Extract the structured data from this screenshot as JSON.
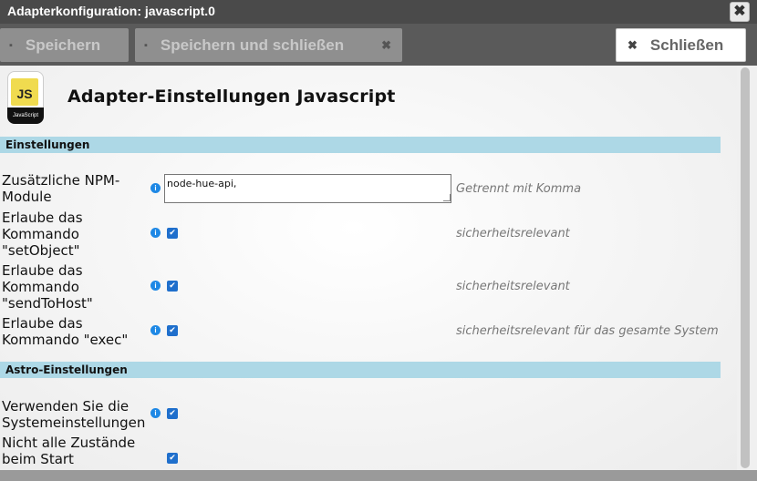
{
  "window": {
    "title": "Adapterkonfiguration: javascript.0",
    "close_glyph": "✖"
  },
  "toolbar": {
    "save_label": "Speichern",
    "save_close_label": "Speichern und schließen",
    "close_label": "Schließen",
    "save_icon": "floppy-icon",
    "close_icon": "x-icon"
  },
  "header": {
    "logo": {
      "badge": "JS",
      "caption": "JavaScript"
    },
    "title": "Adapter-Einstellungen Javascript"
  },
  "sections": [
    {
      "title": "Einstellungen"
    },
    {
      "title": "Astro-Einstellungen"
    }
  ],
  "settings": {
    "npm_label": "Zusätzliche NPM-Module",
    "npm_value": "node-hue-api,",
    "npm_hint": "Getrennt mit Komma",
    "set_object_label": "Erlaube das Kommando \"setObject\"",
    "set_object_checked": true,
    "set_object_hint": "sicherheitsrelevant",
    "send_to_host_label": "Erlaube das Kommando \"sendToHost\"",
    "send_to_host_checked": true,
    "send_to_host_hint": "sicherheitsrelevant",
    "exec_label": "Erlaube das Kommando \"exec\"",
    "exec_checked": true,
    "exec_hint": "sicherheitsrelevant für das gesamte System"
  },
  "astro": {
    "system_settings_label": "Verwenden Sie die Systemeinstellungen",
    "system_settings_checked": true,
    "not_all_states_label": "Nicht alle Zustände beim Start",
    "not_all_states_checked": true
  },
  "glyphs": {
    "info": "i",
    "check": "✔"
  },
  "colors": {
    "section_bg": "#add8e6",
    "checkbox": "#1f6fcc",
    "info": "#1e88e5",
    "js_yellow": "#f0db4f"
  }
}
